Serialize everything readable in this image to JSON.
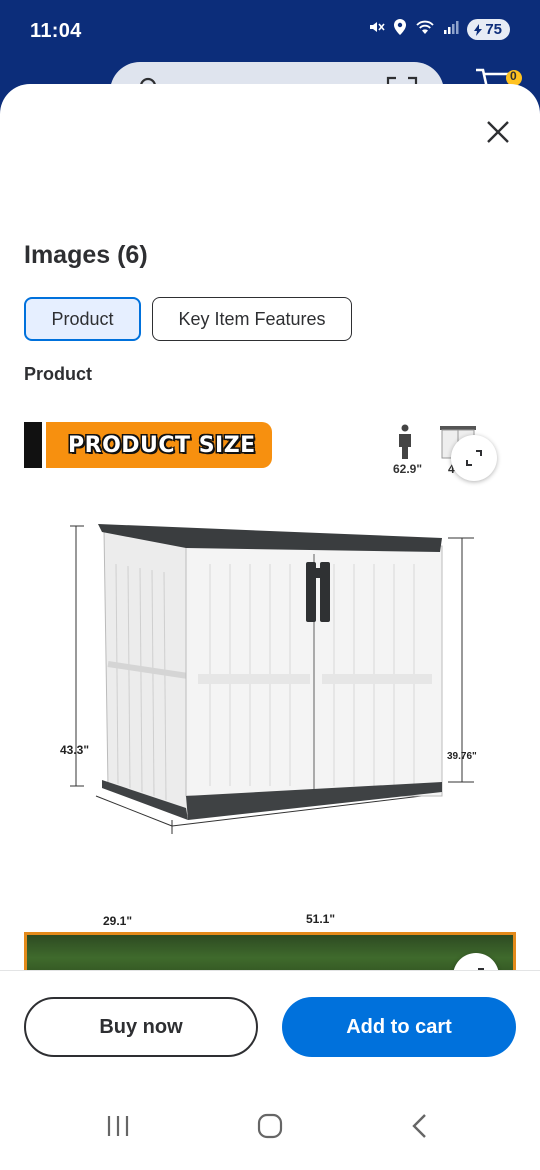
{
  "status_bar": {
    "time": "11:04",
    "battery": "75"
  },
  "header": {
    "cart_count": "0"
  },
  "sheet": {
    "title": "Images (6)",
    "tabs": [
      {
        "label": "Product",
        "selected": true
      },
      {
        "label": "Key Item Features",
        "selected": false
      }
    ],
    "section_label": "Product"
  },
  "product_image": {
    "banner_text": "PRODUCT SIZE",
    "person_height": "62.9\"",
    "mini_label": "4",
    "dimensions": {
      "height_left": "43.3\"",
      "height_right": "39.76\"",
      "depth": "29.1\"",
      "width": "51.1\""
    }
  },
  "actions": {
    "buy_now": "Buy now",
    "add_to_cart": "Add to cart"
  },
  "icons": [
    "mute-icon",
    "location-icon",
    "wifi-icon",
    "signal-icon",
    "battery-icon",
    "search-icon",
    "scan-icon",
    "cart-icon",
    "close-icon",
    "expand-icon",
    "person-icon",
    "recent-apps-icon",
    "home-icon",
    "back-icon"
  ],
  "colors": {
    "primary": "#0071dc",
    "header": "#0c2d7a",
    "banner": "#f7900f",
    "selected_tab_bg": "#e6efff"
  }
}
